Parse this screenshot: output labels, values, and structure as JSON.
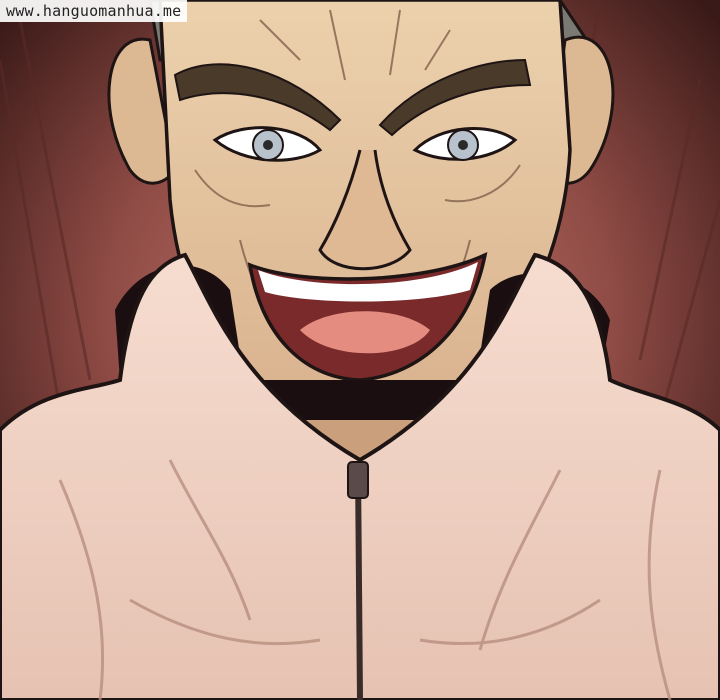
{
  "watermark": {
    "text": "www.hanguomanhua.me"
  },
  "colors": {
    "background_dark": "#3a1a18",
    "background_red": "#8e4a44",
    "skin": "#e9caa4",
    "skin_shadow": "#c79c79",
    "eyebrow": "#4a3a2a",
    "jacket": "#f2d6c6",
    "jacket_shadow": "#d4aea0",
    "collar_inner": "#1a0e10",
    "mouth": "#7a2a2a",
    "tongue": "#e58c80",
    "teeth": "#ffffff",
    "hair": "#7a7a72",
    "outline": "#1e1414"
  }
}
